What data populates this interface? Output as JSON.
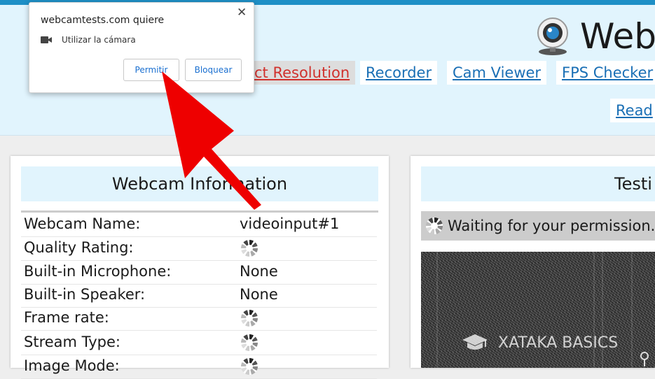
{
  "header": {
    "title": "Webc",
    "nav": {
      "resolution": "ct Resolution",
      "recorder": "Recorder",
      "cam_viewer": "Cam Viewer",
      "fps_checker": "FPS Checker",
      "read": "Read"
    }
  },
  "info_card": {
    "title": "Webcam Information",
    "rows": [
      {
        "label": "Webcam Name:",
        "value": "videoinput#1"
      },
      {
        "label": "Quality Rating:",
        "value": null
      },
      {
        "label": "Built-in Microphone:",
        "value": "None"
      },
      {
        "label": "Built-in Speaker:",
        "value": "None"
      },
      {
        "label": "Frame rate:",
        "value": null
      },
      {
        "label": "Stream Type:",
        "value": null
      },
      {
        "label": "Image Mode:",
        "value": null
      }
    ]
  },
  "test_card": {
    "title": "Testi",
    "status": "Waiting for your permission."
  },
  "watermark": "XATAKA BASICS",
  "permission_popup": {
    "title": "webcamtests.com quiere",
    "permission": "Utilizar la cámara",
    "allow": "Permitir",
    "block": "Bloquear"
  },
  "colors": {
    "accent": "#1e8fc6",
    "header_bg": "#e1f4fd",
    "link": "#1a6fb5",
    "active_link": "#d0312d",
    "arrow": "#ee0000"
  },
  "icons": [
    "webcam-logo-icon",
    "loading-spinner-icon",
    "camera-icon",
    "close-icon",
    "graduation-cap-icon",
    "arrow-annotation"
  ]
}
